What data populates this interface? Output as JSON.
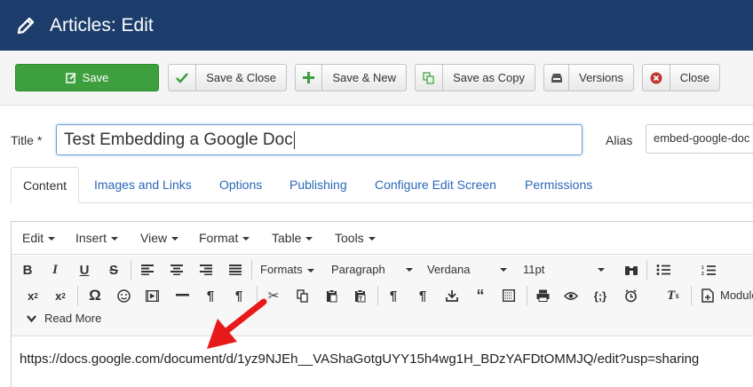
{
  "header": {
    "title": "Articles: Edit",
    "icon": "pencil-icon",
    "bg_color": "#1c3d6b"
  },
  "toolbar": {
    "save": "Save",
    "save_close": "Save & Close",
    "save_new": "Save & New",
    "save_copy": "Save as Copy",
    "versions": "Versions",
    "close": "Close",
    "save_color": "#3e9f3e"
  },
  "form": {
    "title_label": "Title *",
    "title_value": "Test Embedding a Google Doc",
    "alias_label": "Alias",
    "alias_value": "embed-google-doc"
  },
  "tabs": [
    "Content",
    "Images and Links",
    "Options",
    "Publishing",
    "Configure Edit Screen",
    "Permissions"
  ],
  "editor": {
    "menus": [
      "Edit",
      "Insert",
      "View",
      "Format",
      "Table",
      "Tools"
    ],
    "formats": "Formats",
    "block": "Paragraph",
    "font": "Verdana",
    "size": "11pt",
    "module": "Module",
    "read_more": "Read More",
    "content": "https://docs.google.com/document/d/1yz9NJEh__VAShaGotgUYY15h4wg1H_BDzYAFDtOMMJQ/edit?usp=sharing"
  },
  "annotation": {
    "arrow_color": "#e8191a"
  }
}
